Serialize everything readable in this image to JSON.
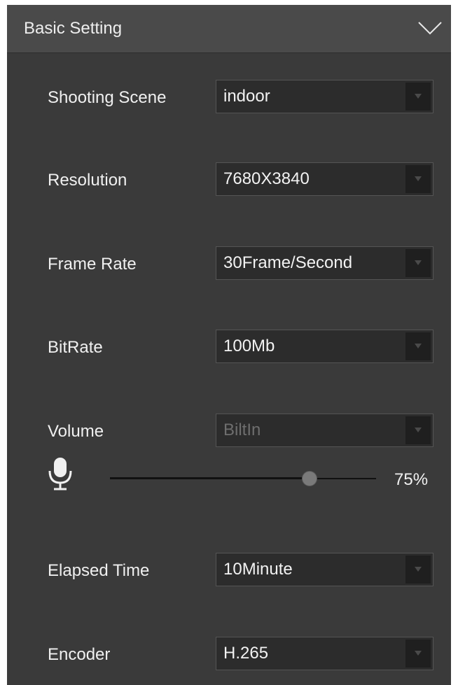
{
  "header": {
    "title": "Basic Setting"
  },
  "settings": [
    {
      "label": "Shooting Scene",
      "value": "indoor",
      "disabled": false
    },
    {
      "label": "Resolution",
      "value": "7680X3840",
      "disabled": false
    },
    {
      "label": "Frame Rate",
      "value": "30Frame/Second",
      "disabled": false
    },
    {
      "label": "BitRate",
      "value": "100Mb",
      "disabled": false
    },
    {
      "label": "Volume",
      "value": "BiltIn",
      "disabled": true
    },
    {
      "label": "Elapsed Time",
      "value": "10Minute",
      "disabled": false
    },
    {
      "label": "Encoder",
      "value": "H.265",
      "disabled": false
    }
  ],
  "volume": {
    "level": 0.75,
    "percent_label": "75%"
  },
  "colors": {
    "panel_bg": "#3a3a3a",
    "header_bg": "#4a4a4a",
    "field_bg": "#2c2c2c",
    "text": "#f0f0f0",
    "disabled_text": "#6e6e6e"
  }
}
